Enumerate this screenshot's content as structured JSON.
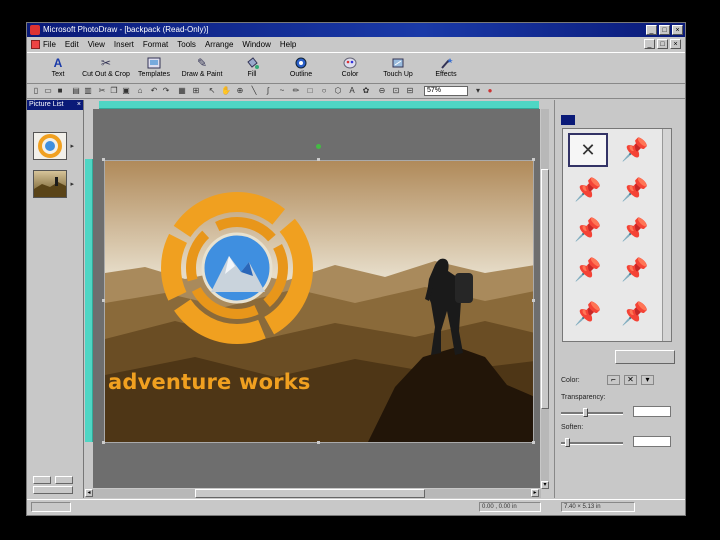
{
  "window": {
    "title": "Microsoft PhotoDraw - [backpack (Read-Only)]"
  },
  "menu": {
    "items": [
      "File",
      "Edit",
      "View",
      "Insert",
      "Format",
      "Tools",
      "Arrange",
      "Window",
      "Help"
    ]
  },
  "toolbar": {
    "tools": [
      {
        "label": "Text",
        "icon": "text-a-icon"
      },
      {
        "label": "Cut Out & Crop",
        "icon": "scissors-icon"
      },
      {
        "label": "Templates",
        "icon": "template-icon"
      },
      {
        "label": "Draw & Paint",
        "icon": "pen-icon"
      },
      {
        "label": "Fill",
        "icon": "fill-bucket-icon"
      },
      {
        "label": "Outline",
        "icon": "outline-icon"
      },
      {
        "label": "Color",
        "icon": "color-icon"
      },
      {
        "label": "Touch Up",
        "icon": "touch-up-icon"
      },
      {
        "label": "Effects",
        "icon": "effects-wand-icon"
      }
    ],
    "zoom": "57%"
  },
  "picture_list": {
    "title": "Picture List"
  },
  "canvas": {
    "brand_text": "adventure works"
  },
  "colors": {
    "titlebar": "#0a1a78",
    "ruler": "#4fd6c4",
    "brand_orange": "#f0a020",
    "logo_blue": "#3f8fe0"
  },
  "right_panel": {
    "color_label": "Color:",
    "transparency_label": "Transparency:",
    "soften_label": "Soften:"
  },
  "status": {
    "position": "0.00 , 0.00 in",
    "size": "7.40 × 5.13 in"
  }
}
